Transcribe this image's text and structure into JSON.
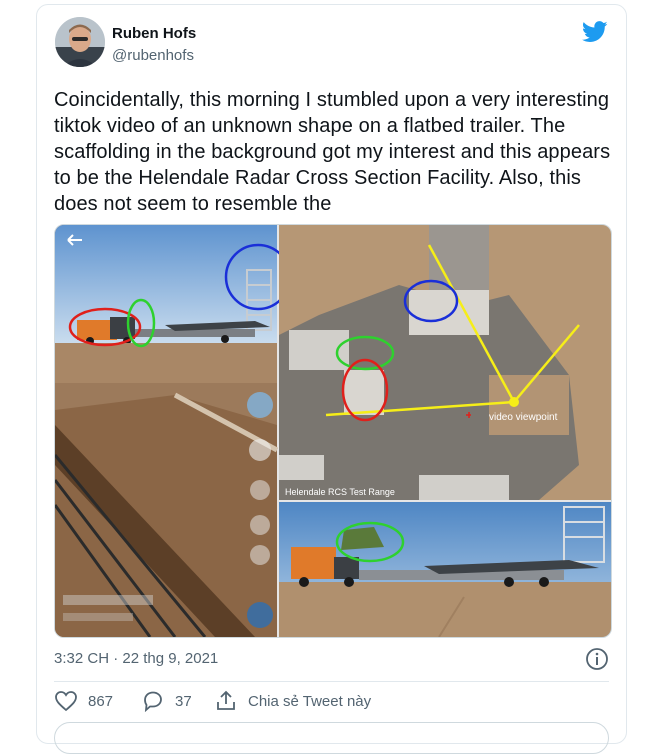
{
  "author": {
    "name": "Ruben Hofs",
    "handle": "@rubenhofs"
  },
  "tweet": {
    "text": "Coincidentally, this morning I stumbled upon a very interesting tiktok video of an unknown shape on a flatbed trailer. The scaffolding in the background got my interest and this appears to be the Helendale Radar Cross Section Facility. Also, this does not seem to resemble the",
    "timestamp": "3:32 CH · 22 thg 9, 2021"
  },
  "media": {
    "map_label": "Helendale RCS Test Range",
    "viewpoint_label": "video viewpoint"
  },
  "actions": {
    "likes": "867",
    "replies": "37",
    "share_label": "Chia sẻ Tweet này"
  },
  "colors": {
    "twitter_blue": "#1d9bf0",
    "circle_red": "#e0201b",
    "circle_green": "#2ed12e",
    "circle_blue": "#1a2fd8",
    "line_yellow": "#f6ee18"
  },
  "icons": [
    "twitter-bird-icon",
    "back-arrow-icon",
    "info-icon",
    "heart-icon",
    "reply-icon",
    "share-icon"
  ]
}
